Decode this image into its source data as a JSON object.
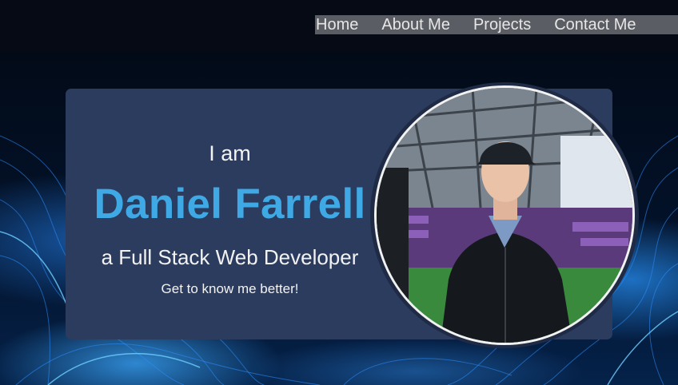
{
  "nav": {
    "links": [
      "Home",
      "About Me",
      "Projects",
      "Contact Me"
    ]
  },
  "hero": {
    "intro": "I am",
    "name": "Daniel Farrell",
    "role": "a Full Stack Web Developer",
    "cta": "Get to know me better!"
  },
  "icons": {
    "profile_photo": "profile-photo-image"
  },
  "colors": {
    "page_background": "#01050d",
    "navbar": "#050a14",
    "nav_highlight": "#5a5d63",
    "card": "#2c3c5f",
    "accent": "#3fa9e5",
    "text": "#f2f2f2"
  }
}
